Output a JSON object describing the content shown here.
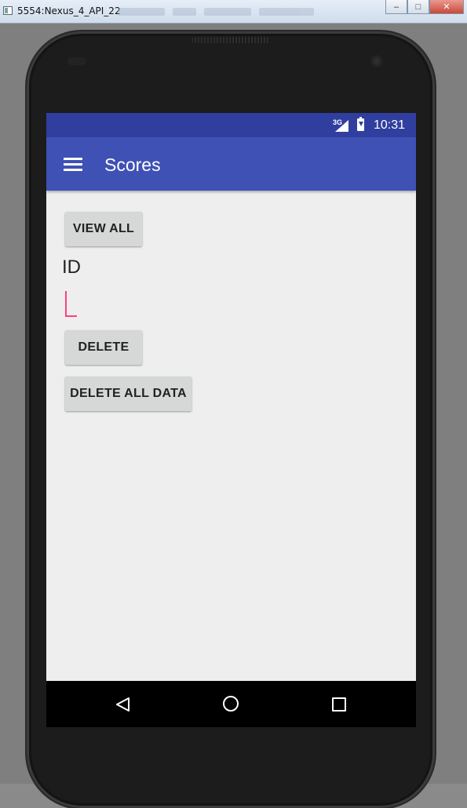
{
  "window": {
    "title": "5554:Nexus_4_API_22",
    "minimize_icon": "minimize-icon",
    "maximize_icon": "maximize-icon",
    "close_icon": "close-icon",
    "close_glyph": "✕"
  },
  "status_bar": {
    "network": "3G",
    "time": "10:31",
    "color": "#303f9f"
  },
  "toolbar": {
    "title": "Scores",
    "menu_icon": "hamburger-menu-icon",
    "color": "#3f51b5"
  },
  "main": {
    "view_all_label": "VIEW ALL",
    "id_label": "ID",
    "id_input_value": "",
    "delete_label": "DELETE",
    "delete_all_label": "DELETE ALL DATA",
    "accent_color": "#ff4081"
  },
  "nav_bar": {
    "back_icon": "back-triangle-icon",
    "home_icon": "home-circle-icon",
    "recents_icon": "recents-square-icon"
  }
}
